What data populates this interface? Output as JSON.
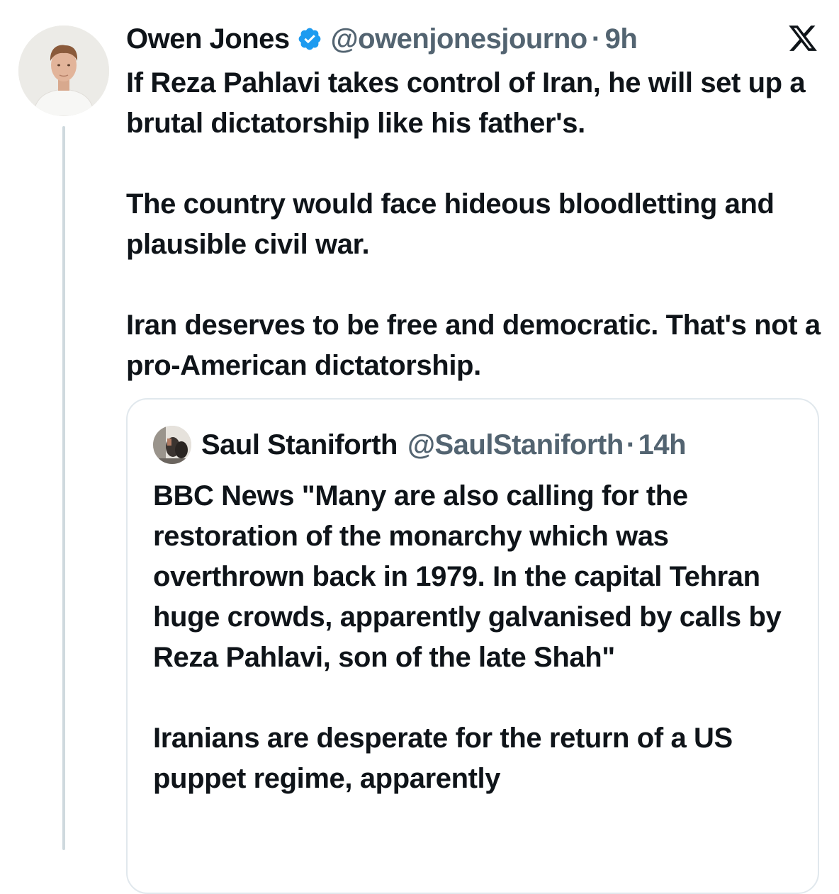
{
  "tweet": {
    "author_name": "Owen Jones",
    "handle": "@owenjonesjourno",
    "separator": "·",
    "time": "9h",
    "paragraphs": [
      "If Reza Pahlavi takes control of Iran, he will set up a brutal dictatorship like his father's.",
      "The country would face hideous bloodletting and plausible civil war.",
      "Iran deserves to be free and democratic. That's not a pro-American dictatorship."
    ]
  },
  "quoted": {
    "author_name": "Saul Staniforth",
    "handle": "@SaulStaniforth",
    "separator": "·",
    "time": "14h",
    "paragraphs": [
      "BBC News \"Many are also calling for the restoration of the monarchy which was overthrown back in 1979. In the capital Tehran huge crowds, apparently galvanised by calls by Reza Pahlavi, son of the late Shah\"",
      "Iranians are desperate for the return of a US puppet regime, apparently"
    ]
  },
  "icons": {
    "verified": "verified-badge-icon",
    "logo": "x-logo-icon"
  },
  "colors": {
    "verified_blue": "#1d9bf0",
    "secondary_text": "#536471",
    "primary_text": "#0f1419",
    "border": "#e1e8ed",
    "thread_line": "#cfd9de"
  }
}
